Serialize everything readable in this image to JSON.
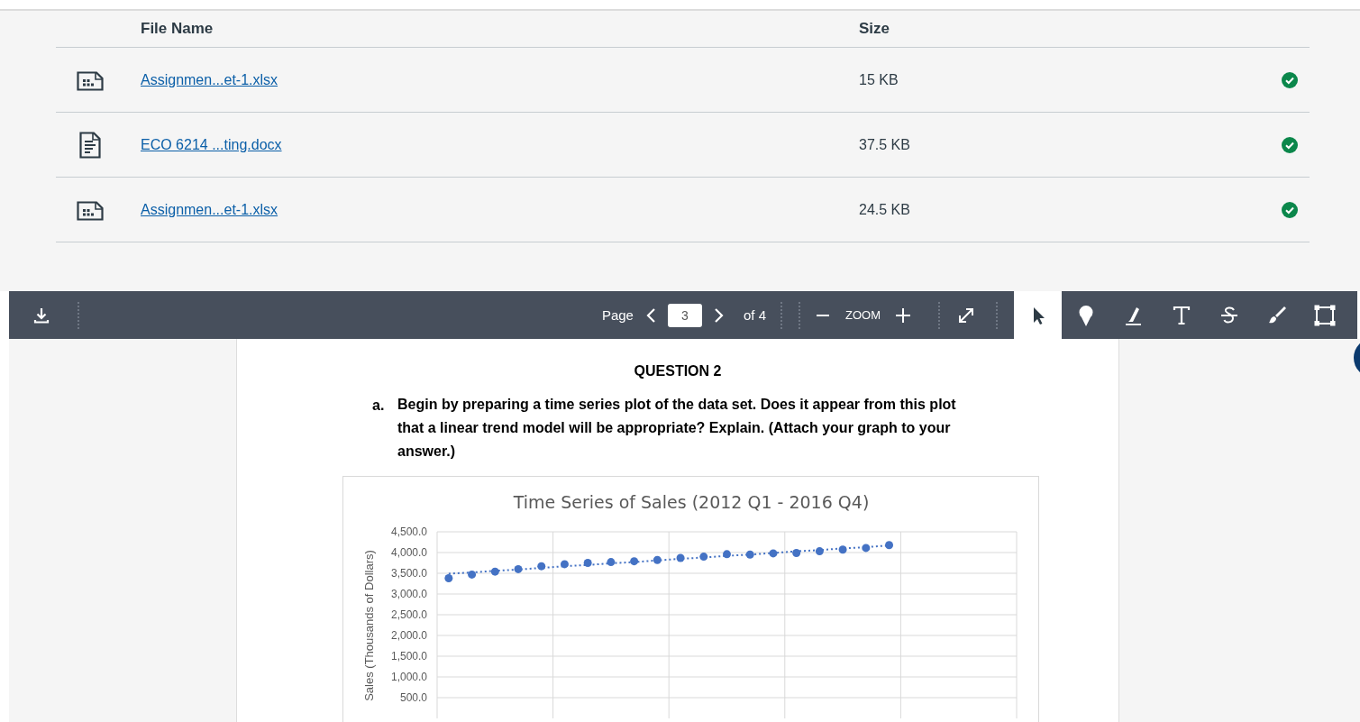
{
  "files": {
    "columns": [
      "File Name",
      "Size"
    ],
    "rows": [
      {
        "name": "Assignmen...et-1.xlsx",
        "kind": "spreadsheet",
        "size": "15 KB",
        "complete": true
      },
      {
        "name": "ECO 6214 ...ting.docx",
        "kind": "document",
        "size": "37.5 KB",
        "complete": true
      },
      {
        "name": "Assignmen...et-1.xlsx",
        "kind": "spreadsheet",
        "size": "24.5 KB",
        "complete": true
      }
    ]
  },
  "toolbar": {
    "page_label": "Page",
    "page": "3",
    "page_total": "of 4",
    "zoom_label": "ZOOM",
    "tools": [
      {
        "kind": "pointer",
        "selected": true
      },
      {
        "kind": "pin",
        "selected": false
      },
      {
        "kind": "highlight",
        "selected": false
      },
      {
        "kind": "text",
        "selected": false
      },
      {
        "kind": "strike",
        "selected": false
      },
      {
        "kind": "brush",
        "selected": false
      },
      {
        "kind": "area",
        "selected": false
      }
    ]
  },
  "document": {
    "heading": "QUESTION 2",
    "items": [
      {
        "marker": "a.",
        "text": "Begin by preparing a time series plot of the data set. Does it appear from this plot that a linear trend model will be appropriate? Explain. (Attach your graph to your answer.)"
      }
    ],
    "chart_data": {
      "type": "scatter",
      "title": "Time Series of Sales (2012 Q1 - 2016 Q4)",
      "ylabel": "Sales (Thousands of Dollars)",
      "categories": [
        null,
        null,
        null,
        null,
        null,
        null,
        null,
        null,
        null,
        null,
        null,
        null,
        null,
        null,
        null,
        null,
        null,
        null,
        null,
        null,
        null,
        null,
        null,
        null,
        null
      ],
      "grid": true,
      "series": [
        {
          "color": "#4472c4",
          "values": [
            3380,
            3470,
            3540,
            3600,
            3670,
            3720,
            3750,
            3770,
            3790,
            3820,
            3870,
            3900,
            3960,
            3950,
            3980,
            3990,
            4030,
            4070,
            4110,
            4180,
            null,
            null,
            null,
            null,
            null
          ]
        },
        {
          "type": "line",
          "line_style": "dotted",
          "color": "#4472c4",
          "values": [
            3490,
            3520,
            3560,
            3590,
            3630,
            3670,
            3700,
            3740,
            3770,
            3810,
            3850,
            3880,
            3920,
            3950,
            3990,
            4030,
            4060,
            4100,
            4130,
            4170,
            null,
            null,
            null,
            null,
            null
          ]
        }
      ],
      "ylim": [
        0,
        4500
      ],
      "yticks": [
        {
          "value": 500,
          "label": "500.0"
        },
        {
          "value": 1000,
          "label": "1,000.0"
        },
        {
          "value": 1500,
          "label": "1,500.0"
        },
        {
          "value": 2000,
          "label": "2,000.0"
        },
        {
          "value": 2500,
          "label": "2,500.0"
        },
        {
          "value": 3000,
          "label": "3,000.0"
        },
        {
          "value": 3500,
          "label": "3,500.0"
        },
        {
          "value": 4000,
          "label": "4,000.0"
        },
        {
          "value": 4500,
          "label": "4,500.0"
        }
      ]
    }
  }
}
